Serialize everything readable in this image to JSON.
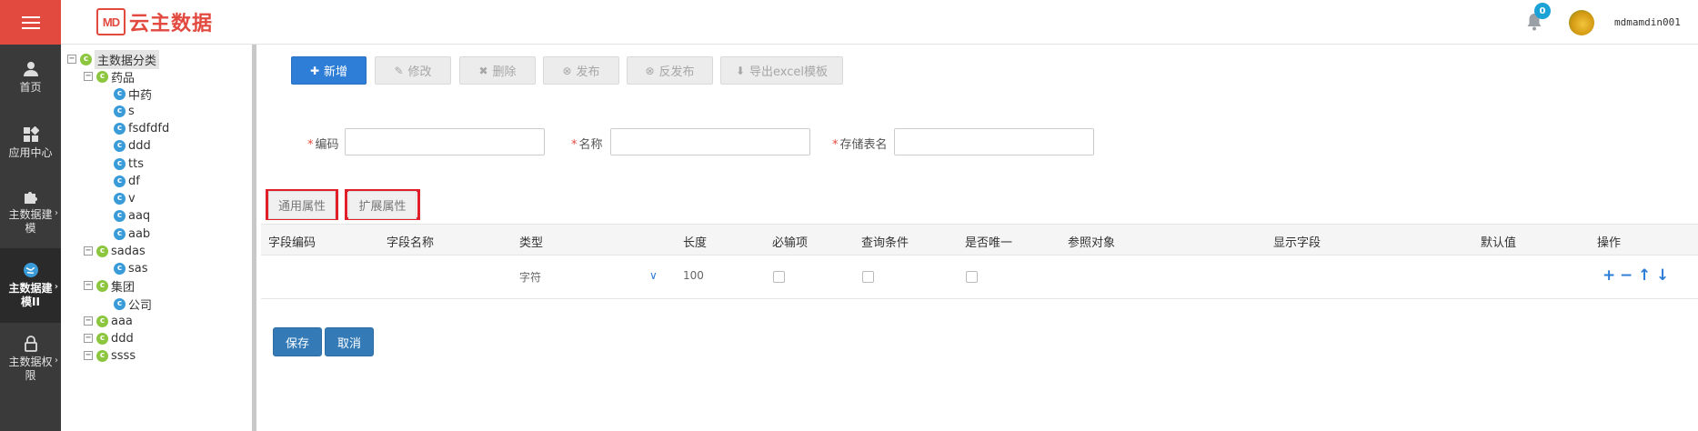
{
  "header": {
    "logo_mark": "MD",
    "logo_text": "云主数据",
    "notification_count": "0",
    "username": "mdmamdin001"
  },
  "sidenav": {
    "items": [
      {
        "label": "首页",
        "icon": "user-icon"
      },
      {
        "label": "应用中心",
        "icon": "apps-icon"
      },
      {
        "label": "主数据建模",
        "icon": "puzzle-icon"
      },
      {
        "label": "主数据建模II",
        "icon": "globe-icon"
      },
      {
        "label": "主数据权限",
        "icon": "lock-icon"
      }
    ]
  },
  "tree": {
    "root": "主数据分类",
    "nodes": [
      {
        "label": "药品",
        "level": 1
      },
      {
        "label": "中药",
        "level": 2
      },
      {
        "label": "s",
        "level": 2
      },
      {
        "label": "fsdfdfd",
        "level": 2
      },
      {
        "label": "ddd",
        "level": 2
      },
      {
        "label": "tts",
        "level": 2
      },
      {
        "label": "df",
        "level": 2
      },
      {
        "label": "v",
        "level": 2
      },
      {
        "label": "aaq",
        "level": 2
      },
      {
        "label": "aab",
        "level": 2
      },
      {
        "label": "sadas",
        "level": 1
      },
      {
        "label": "sas",
        "level": 2
      },
      {
        "label": "集团",
        "level": 1
      },
      {
        "label": "公司",
        "level": 2
      },
      {
        "label": "aaa",
        "level": 1
      },
      {
        "label": "ddd",
        "level": 1
      },
      {
        "label": "ssss",
        "level": 1
      }
    ]
  },
  "toolbar": {
    "add": "新增",
    "edit": "修改",
    "delete": "删除",
    "publish": "发布",
    "unpublish": "反发布",
    "export": "导出excel模板"
  },
  "form": {
    "code_label": "编码",
    "code_value": "",
    "name_label": "名称",
    "name_value": "",
    "table_label": "存储表名",
    "table_value": ""
  },
  "tabs": {
    "common": "通用属性",
    "extended": "扩展属性"
  },
  "grid": {
    "headers": [
      "字段编码",
      "字段名称",
      "类型",
      "长度",
      "必输项",
      "查询条件",
      "是否唯一",
      "参照对象",
      "显示字段",
      "默认值",
      "操作"
    ],
    "row": {
      "field_code": "",
      "field_name": "",
      "type": "字符",
      "length": "100"
    }
  },
  "actions": {
    "save": "保存",
    "cancel": "取消"
  },
  "colors": {
    "brand_red": "#e2493f",
    "primary_blue": "#2e7dd6",
    "highlight_red": "#e01f2a",
    "nav_dark": "#3a3a3a"
  }
}
